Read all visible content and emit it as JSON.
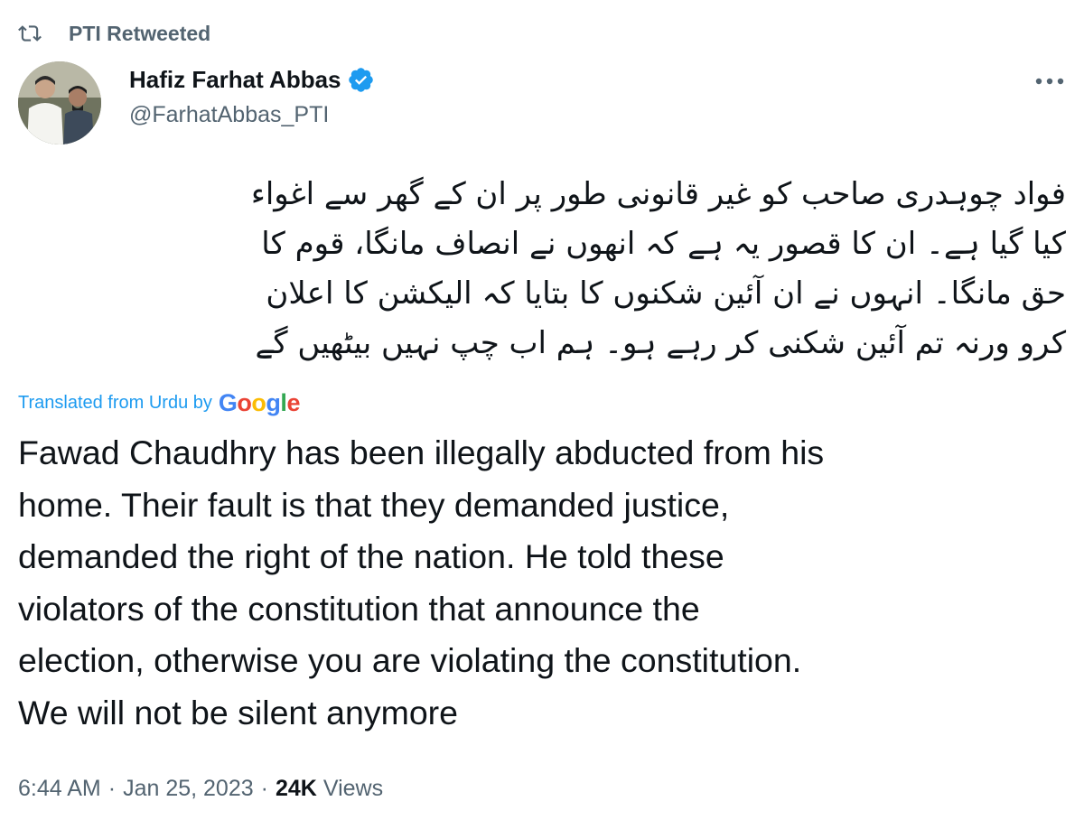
{
  "retweet": {
    "icon": "retweet-icon",
    "label": "PTI Retweeted"
  },
  "author": {
    "avatar": "avatar",
    "name": "Hafiz Farhat Abbas",
    "verified_icon": "verified-badge-icon",
    "handle": "@FarhatAbbas_PTI",
    "more_icon": "more-options-icon"
  },
  "tweet": {
    "urdu_lines": [
      "فواد چوہدری صاحب کو غیر قانونی طور پر ان کے گھر سے اغواء",
      "کیا گیا ہے۔ ان کا قصور یہ ہے کہ انھوں نے انصاف مانگا، قوم کا",
      "حق مانگا۔ انہوں نے ان آئین شکنوں کا بتایا کہ الیکشن کا اعلان",
      "کرو ورنہ تم آئین شکنی کر رہے ہو۔ ہم اب چپ نہیں بیٹھیں گے"
    ],
    "translated_label": "Translated from Urdu by",
    "translation_provider": "Google",
    "english_lines": [
      "Fawad Chaudhry has been illegally abducted from his",
      "home. Their fault is that they demanded justice,",
      "demanded the right of the nation. He told these",
      "violators of the constitution that announce the",
      "election, otherwise you are violating the constitution.",
      "We will not be silent anymore"
    ]
  },
  "meta": {
    "time": "6:44 AM",
    "separator": "·",
    "date": "Jan 25, 2023",
    "views_count": "24K",
    "views_label": "Views"
  },
  "colors": {
    "text_primary": "#0f1419",
    "text_secondary": "#536471",
    "link_blue": "#1d9bf0",
    "verified_blue": "#1d9bf0",
    "google_blue": "#4285f4",
    "google_red": "#ea4335",
    "google_yellow": "#fbbc05",
    "google_green": "#34a853"
  }
}
